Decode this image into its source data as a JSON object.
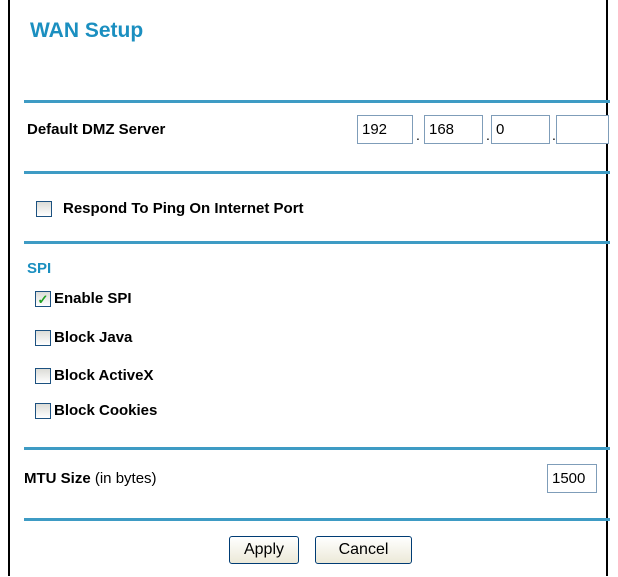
{
  "title": "WAN Setup",
  "dmz": {
    "label": "Default DMZ Server",
    "octets": [
      "192",
      "168",
      "0",
      ""
    ],
    "separator": "."
  },
  "ping": {
    "label": "Respond To Ping On Internet Port",
    "checked": false
  },
  "spi": {
    "heading": "SPI",
    "options": [
      {
        "label": "Enable SPI",
        "checked": true
      },
      {
        "label": "Block Java",
        "checked": false
      },
      {
        "label": "Block ActiveX",
        "checked": false
      },
      {
        "label": "Block Cookies",
        "checked": false
      }
    ]
  },
  "mtu": {
    "label": "MTU Size",
    "unit": "(in bytes)",
    "value": "1500"
  },
  "buttons": {
    "apply": "Apply",
    "cancel": "Cancel"
  },
  "colors": {
    "accent": "#1b8fc0",
    "rule": "#3e9bc4",
    "check": "#21a121"
  }
}
